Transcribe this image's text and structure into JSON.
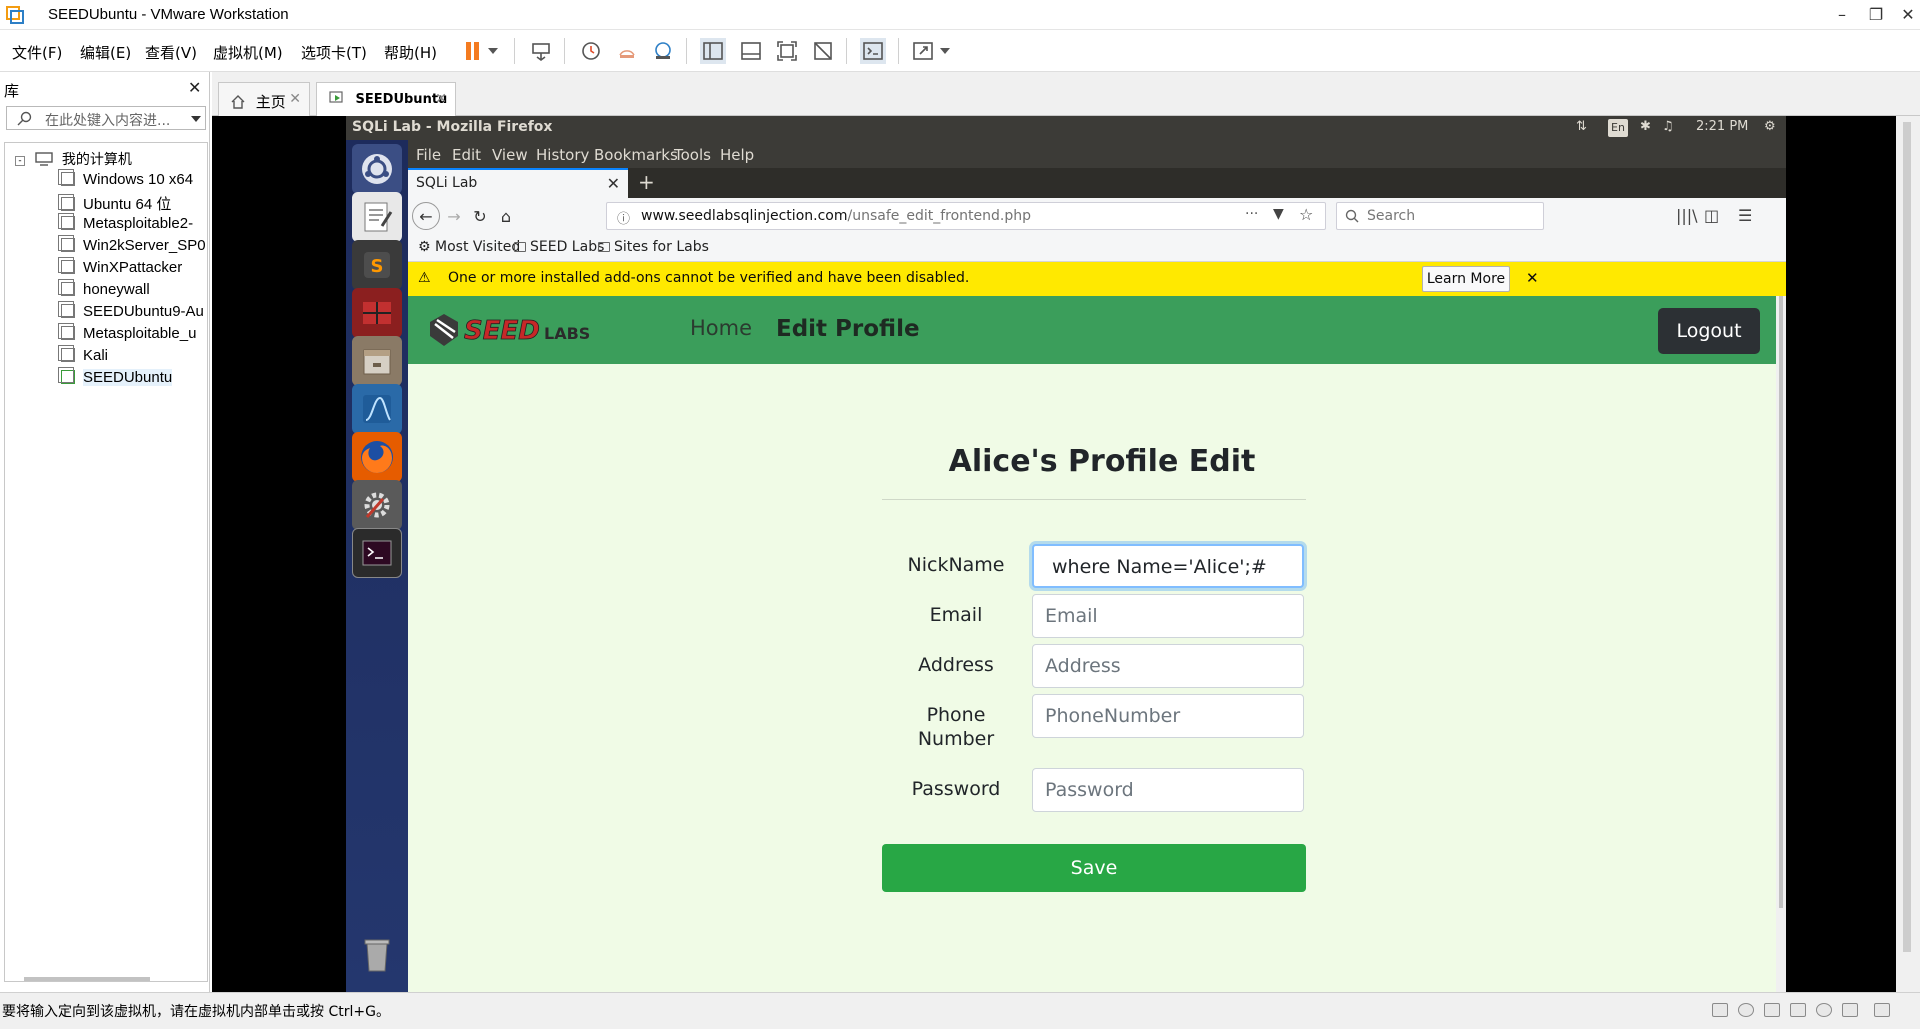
{
  "vmware": {
    "title": "SEEDUbuntu - VMware Workstation",
    "menu": [
      "文件(F)",
      "编辑(E)",
      "查看(V)",
      "虚拟机(M)",
      "选项卡(T)",
      "帮助(H)"
    ],
    "library": {
      "title": "库",
      "search_placeholder": "在此处键入内容进...",
      "root": "我的计算机",
      "items": [
        "Windows 10 x64",
        "Ubuntu 64 位",
        "Metasploitable2-",
        "Win2kServer_SP0",
        "WinXPattacker",
        "honeywall",
        "SEEDUbuntu9-Au",
        "Metasploitable_u",
        "Kali",
        "SEEDUbuntu"
      ],
      "selected": "SEEDUbuntu"
    },
    "tabs": [
      {
        "label": "主页"
      },
      {
        "label": "SEEDUbuntu"
      }
    ],
    "status_hint": "要将输入定向到该虚拟机，请在虚拟机内部单击或按 Ctrl+G。"
  },
  "ubuntu": {
    "window_title": "SQLi Lab - Mozilla Firefox",
    "indicators": {
      "keyboard": "En",
      "time": "2:21 PM"
    }
  },
  "firefox": {
    "menu": [
      "File",
      "Edit",
      "View",
      "History",
      "Bookmarks",
      "Tools",
      "Help"
    ],
    "tab_title": "SQLi Lab",
    "url_host": "www.seedlabsqlinjection.com",
    "url_path": "/unsafe_edit_frontend.php",
    "search_placeholder": "Search",
    "bookmarks": [
      "Most Visited",
      "SEED Labs",
      "Sites for Labs"
    ],
    "notification": {
      "message": "One or more installed add-ons cannot be verified and have been disabled.",
      "button": "Learn More"
    }
  },
  "webpage": {
    "nav": {
      "home": "Home",
      "edit_profile": "Edit Profile",
      "logout": "Logout"
    },
    "form": {
      "title": "Alice's Profile Edit",
      "nickname_label": "NickName",
      "nickname_value": "where Name='Alice';#",
      "email_label": "Email",
      "email_placeholder": "Email",
      "address_label": "Address",
      "address_placeholder": "Address",
      "phone_label_1": "Phone",
      "phone_label_2": "Number",
      "phone_placeholder": "PhoneNumber",
      "password_label": "Password",
      "password_placeholder": "Password",
      "save": "Save"
    }
  },
  "colors": {
    "navbar": "#3b9e5b",
    "page_bg": "#f0fbe6",
    "save_button": "#28a745",
    "notification": "#ffe900",
    "launcher": "#1d2b5c"
  }
}
